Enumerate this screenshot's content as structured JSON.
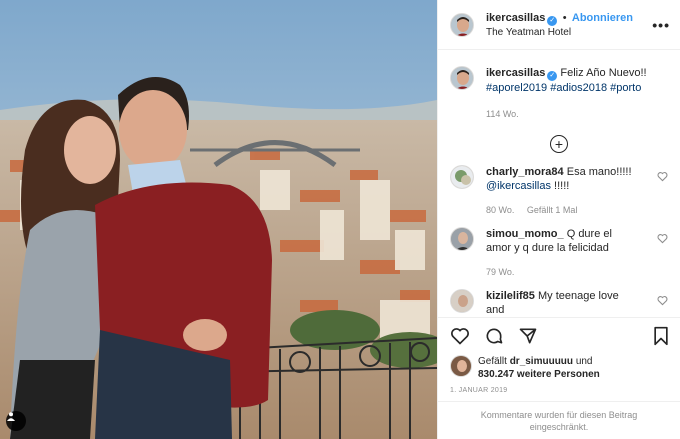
{
  "post": {
    "username": "ikercasillas",
    "follow_label": "Abonnieren",
    "location": "The Yeatman Hotel",
    "separator": "•",
    "more_icon": "more-horizontal-icon"
  },
  "caption": {
    "username": "ikercasillas",
    "text": "Feliz Año Nuevo!!",
    "hashtags": "#aporel2019 #adios2018 #porto",
    "time": "114 Wo."
  },
  "comments": [
    {
      "username": "charly_mora84",
      "text": "Esa mano!!!!!",
      "mention": "@ikercasillas",
      "after": " !!!!!",
      "time": "80 Wo.",
      "likes": "Gefällt 1 Mal"
    },
    {
      "username": "simou_momo_",
      "text": "Q dure el amor y q dure la felicidad",
      "time": "79 Wo."
    },
    {
      "username": "kizilelif85",
      "text": "My teenage love and"
    }
  ],
  "likes": {
    "prefix": "Gefällt",
    "user": "dr_simuuuuu",
    "joiner": "und",
    "count": "830.247 weitere Personen"
  },
  "date": "1. JANUAR 2019",
  "comments_disabled": "Kommentare wurden für diesen Beitrag eingeschränkt.",
  "colors": {
    "link": "#3897f0",
    "hashtag": "#003569",
    "muted": "#8e8e8e",
    "text": "#262626",
    "sweater": "#8a1f22"
  }
}
